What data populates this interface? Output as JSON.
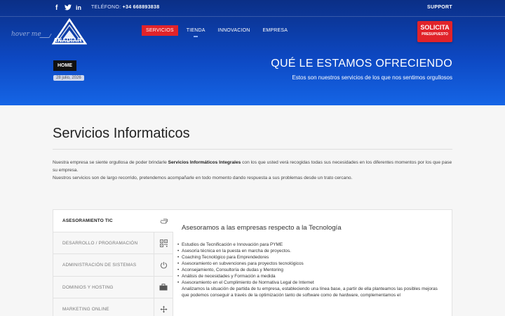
{
  "topbar": {
    "phone_label": "TELÉFONO:",
    "phone_number": "+34 668893838",
    "support": "SUPPORT",
    "social": [
      "facebook-icon",
      "twitter-icon",
      "linkedin-icon"
    ]
  },
  "header": {
    "hover_text": "hover me",
    "logo_text": "ANADIAIT",
    "nav": [
      {
        "label": "SERVICIOS",
        "active": true
      },
      {
        "label": "TIENDA"
      },
      {
        "label": "INNOVACION"
      },
      {
        "label": "EMPRESA"
      }
    ],
    "cta_line1": "SOLICITA",
    "cta_line2": "PRESUPUESTO"
  },
  "hero": {
    "breadcrumb": "HOME",
    "date": "28 julio, 2026",
    "title": "QUÉ LE ESTAMOS OFRECIENDO",
    "subtitle": "Estos son nuestros servicios de los que nos sentimos orgullosos"
  },
  "main": {
    "title": "Servicios Informaticos",
    "intro_pre": "Nuestra empresa se siente orgullosa de poder brindarle ",
    "intro_bold": "Servicios Informáticos Integrales",
    "intro_post": " con los que usted verá recogidas todas sus necesidades en los diferentes momentos por los que pase su empresa.",
    "intro_line2": "Nuestros servicios son de largo recorrido, pretendemos acompañarle en todo momento dando respuesta a sus problemas desde un trato cercano."
  },
  "tabs": [
    {
      "label": "ASESORAMIENTO TIC",
      "icon": "hand-pointer-icon",
      "active": true
    },
    {
      "label": "DESARROLLO / PROGRAMACIÓN",
      "icon": "qr-code-icon"
    },
    {
      "label": "ADMINISTRACIÓN DE SISTEMAS",
      "icon": "power-icon"
    },
    {
      "label": "DOMINIOS Y HOSTING",
      "icon": "briefcase-icon"
    },
    {
      "label": "MARKETING ONLINE",
      "icon": "move-icon"
    }
  ],
  "content": {
    "title": "Asesoramos a las empresas respecto a la Tecnología",
    "bullets": [
      "Estudios de Tecnificación e Innovación para PYME",
      "Asesoría técnica en la puesta en marcha de proyectos.",
      "Coaching Tecnológico para Emprendedores",
      "Asesoramiento en subvenciones para proyectos tecnológicos",
      "Aconsejamiento, Consultoría de dudas y Mentoring",
      "Análisis de necesidades y Formación a medida",
      "Asesoramiento en el Cumplimiento de Normativa Legal de Internet"
    ],
    "paragraph": "Analizamos la situación de partida de tu empresa, estableciendo una línea base, a partir de ella planteamos las posibles mejoras que podemos conseguir a través de la optimización tanto de software como de hardware, complementamos el"
  },
  "colors": {
    "accent_red": "#e1232a",
    "hero_blue": "#0d48c2"
  }
}
